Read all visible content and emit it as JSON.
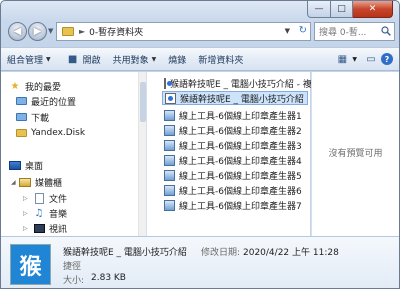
{
  "address": {
    "path": "0-暫存資料夾",
    "search_placeholder": "搜尋 0-暫..."
  },
  "toolbar": {
    "organize": "組合管理",
    "open": "開啟",
    "share": "共用對象",
    "burn": "燒錄",
    "new_folder": "新增資料夾"
  },
  "sidebar": {
    "favorites": "我的最愛",
    "recent": "最近的位置",
    "downloads": "下載",
    "yandex": "Yandex.Disk",
    "desktop": "桌面",
    "libraries": "媒體櫃",
    "documents": "文件",
    "music": "音樂",
    "videos": "視訊"
  },
  "files": [
    "猴語幹技呢E _ 電腦小技巧介紹 - 複製",
    "猴語幹技呢E _ 電腦小技巧介紹",
    "線上工具-6個線上印章產生器1",
    "線上工具-6個線上印章產生器2",
    "線上工具-6個線上印章產生器3",
    "線上工具-6個線上印章產生器4",
    "線上工具-6個線上印章產生器5",
    "線上工具-6個線上印章產生器6",
    "線上工具-6個線上印章產生器7"
  ],
  "preview": {
    "text": "沒有預覽可用"
  },
  "details": {
    "thumb_char": "猴",
    "name": "猴語幹技呢E _ 電腦小技巧介紹",
    "modified_label": "修改日期:",
    "modified_value": "2020/4/22 上午 11:28",
    "type": "捷徑",
    "size_label": "大小:",
    "size_value": "2.83 KB"
  }
}
